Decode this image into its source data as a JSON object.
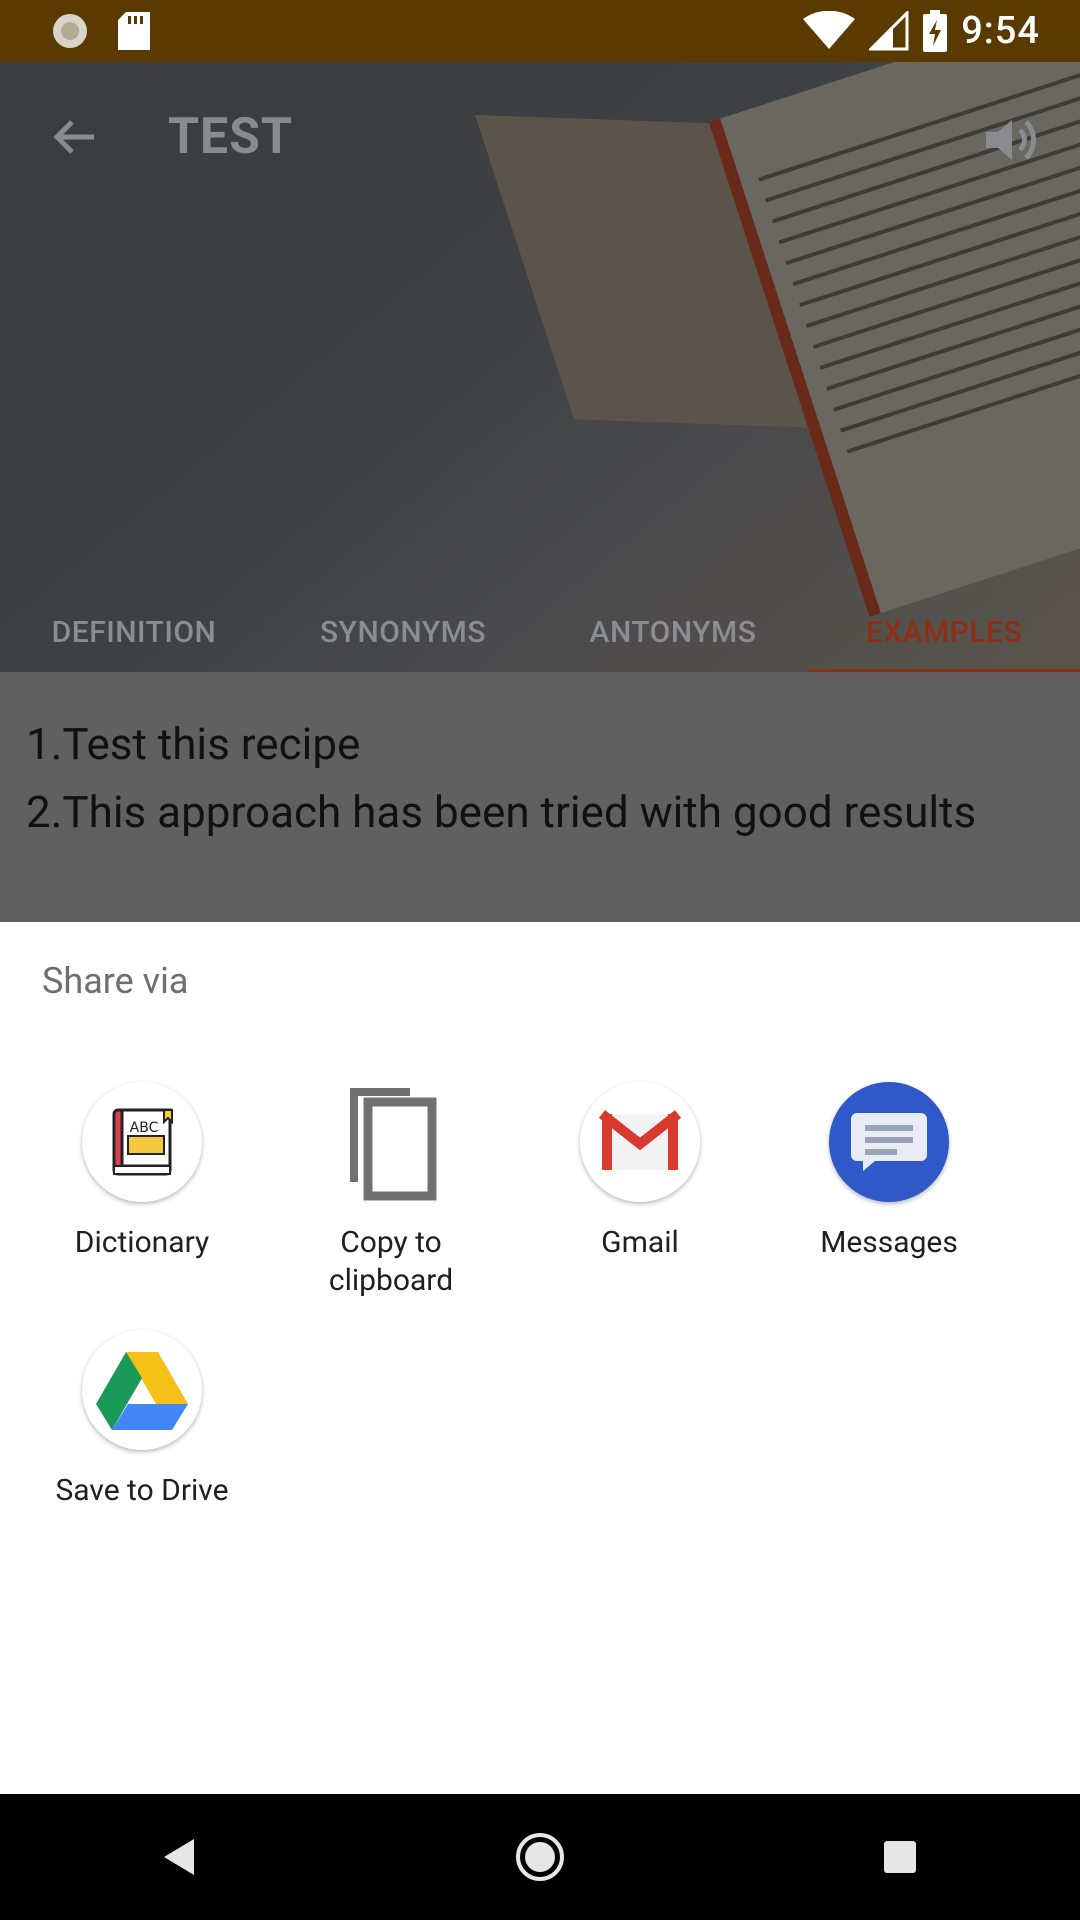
{
  "status_bar": {
    "time": "9:54",
    "icons": [
      "settings-notification-icon",
      "sd-card-icon",
      "wifi-icon",
      "cell-signal-icon",
      "battery-charging-icon"
    ]
  },
  "app": {
    "title": "TEST",
    "tabs": [
      {
        "label": "DEFINITION"
      },
      {
        "label": "SYNONYMS"
      },
      {
        "label": "ANTONYMS"
      },
      {
        "label": "EXAMPLES",
        "selected": true
      }
    ],
    "examples": [
      "1.Test this recipe",
      "2.This approach has been tried with good results"
    ]
  },
  "share_sheet": {
    "title": "Share via",
    "targets": [
      {
        "label": "Dictionary",
        "icon": "dictionary-icon"
      },
      {
        "label": "Copy to clipboard",
        "label_line1": "Copy to",
        "label_line2": "clipboard",
        "icon": "copy-icon"
      },
      {
        "label": "Gmail",
        "icon": "gmail-icon"
      },
      {
        "label": "Messages",
        "icon": "messages-icon"
      },
      {
        "label": "Save to Drive",
        "icon": "drive-icon"
      }
    ]
  },
  "navigation_bar": {
    "buttons": [
      "back-nav-icon",
      "home-nav-icon",
      "recents-nav-icon"
    ]
  },
  "colors": {
    "status_bar": "#5a3a00",
    "accent": "#8e2e15",
    "sheet_bg": "#ffffff"
  }
}
